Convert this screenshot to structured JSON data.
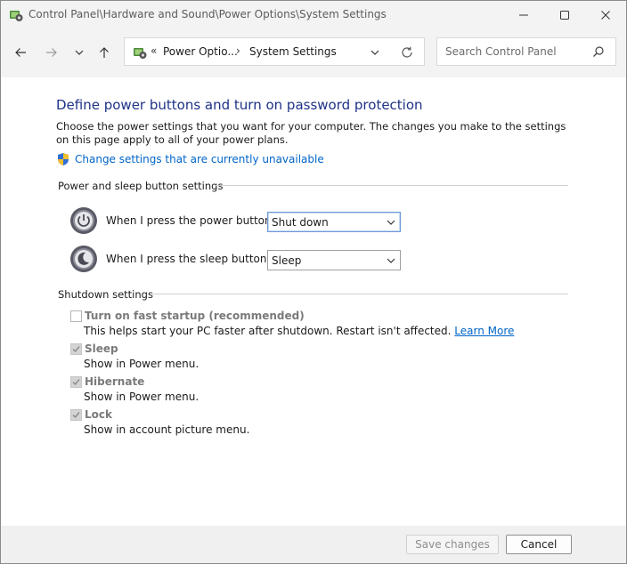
{
  "window": {
    "title": "Control Panel\\Hardware and Sound\\Power Options\\System Settings"
  },
  "nav": {
    "breadcrumb_overflow": "«",
    "breadcrumb_1": "Power Optio...",
    "breadcrumb_sep": "›",
    "breadcrumb_2": "System Settings",
    "search_placeholder": "Search Control Panel"
  },
  "page": {
    "heading": "Define power buttons and turn on password protection",
    "description": "Choose the power settings that you want for your computer. The changes you make to the settings on this page apply to all of your power plans.",
    "change_link": "Change settings that are currently unavailable"
  },
  "power_sleep": {
    "group_label": "Power and sleep button settings",
    "power_label": "When I press the power button:",
    "power_value": "Shut down",
    "sleep_label": "When I press the sleep button:",
    "sleep_value": "Sleep"
  },
  "shutdown": {
    "group_label": "Shutdown settings",
    "items": [
      {
        "title": "Turn on fast startup (recommended)",
        "desc": "This helps start your PC faster after shutdown. Restart isn't affected.",
        "link": "Learn More",
        "checked": false
      },
      {
        "title": "Sleep",
        "desc": "Show in Power menu.",
        "checked": true
      },
      {
        "title": "Hibernate",
        "desc": "Show in Power menu.",
        "checked": true
      },
      {
        "title": "Lock",
        "desc": "Show in account picture menu.",
        "checked": true
      }
    ]
  },
  "footer": {
    "save_label": "Save changes",
    "cancel_label": "Cancel"
  },
  "colors": {
    "heading": "#1e3287",
    "link": "#0064c8",
    "chrome": "#f3f3f3"
  },
  "icons": {
    "app": "control-panel-icon",
    "back": "arrow-left-icon",
    "forward": "arrow-right-icon",
    "recent": "chevron-down-icon",
    "up": "arrow-up-icon",
    "refresh": "refresh-icon",
    "search": "search-icon",
    "shield": "uac-shield-icon",
    "power": "power-button-icon",
    "sleep": "sleep-button-icon"
  }
}
